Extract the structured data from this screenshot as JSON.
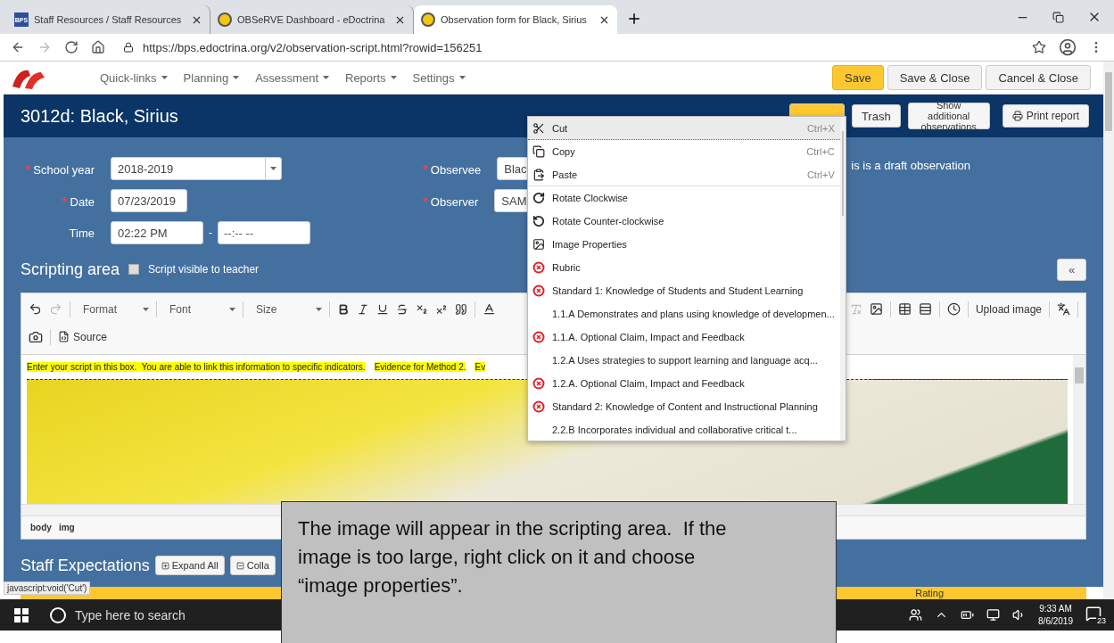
{
  "browser": {
    "tabs": [
      {
        "label": "Staff Resources / Staff Resources",
        "favicon": "BPS",
        "selected": false
      },
      {
        "label": "OBSeRVE Dashboard - eDoctrina",
        "selected": false
      },
      {
        "label": "Observation form for Black, Sirius",
        "selected": true
      }
    ],
    "url": "https://bps.edoctrina.org/v2/observation-script.html?rowid=156251"
  },
  "nav": {
    "menus": [
      "Quick-links",
      "Planning",
      "Assessment",
      "Reports",
      "Settings"
    ],
    "buttons": [
      {
        "label": "Save",
        "primary": true
      },
      {
        "label": "Save & Close",
        "primary": false
      },
      {
        "label": "Cancel & Close",
        "primary": false
      }
    ]
  },
  "header": {
    "title": "3012d: Black, Sirius",
    "buttons": [
      {
        "kind": "status"
      },
      {
        "kind": "plain",
        "label": "Trash"
      },
      {
        "kind": "plain",
        "label": "Show additional observations"
      },
      {
        "kind": "print",
        "label": "Print report"
      }
    ]
  },
  "form": {
    "left": [
      {
        "kind": "select",
        "marker": "*",
        "label": "School year",
        "value": "2018-2019"
      },
      {
        "kind": "date",
        "marker": "*",
        "label": "Date",
        "value": "07/23/2019"
      },
      {
        "kind": "time",
        "label": "Time",
        "value": "02:22 PM",
        "separator": "-",
        "end": {
          "placeholder": "--:-- --"
        }
      }
    ],
    "right": [
      {
        "marker": "*",
        "label": "Observee",
        "value": "Blac"
      },
      {
        "marker": "*",
        "label": "Observer",
        "value": "SAM"
      }
    ],
    "draft_note": "is is a draft observation"
  },
  "scripting": {
    "title": "Scripting area",
    "visible_to_teacher": {
      "label": "Script visible to teacher",
      "checked": false
    },
    "collapse": "«"
  },
  "editor": {
    "dropdowns": [
      "Format",
      "Font",
      "Size"
    ],
    "source": "Source",
    "upload": "Upload image",
    "segments": [
      "Enter your script in this box.  You are able to link this information to specific indicators.",
      "Evidence for Method 2.",
      "Ev"
    ],
    "path": [
      "body",
      "img"
    ]
  },
  "staff": {
    "title": "Staff Expectations",
    "buttons": [
      {
        "kind": "expand",
        "label": "Expand All"
      },
      {
        "kind": "collapse",
        "label": "Colla"
      }
    ],
    "rating": "Rating"
  },
  "status_link": "javascript:void('Cut')",
  "context_menu": {
    "items": [
      {
        "kind": "cut",
        "label": "Cut",
        "shortcut": "Ctrl+X",
        "highlighted": true,
        "separator_after": false
      },
      {
        "kind": "copy",
        "label": "Copy",
        "shortcut": "Ctrl+C",
        "highlighted": false,
        "separator_after": false
      },
      {
        "kind": "paste",
        "label": "Paste",
        "shortcut": "Ctrl+V",
        "highlighted": false,
        "separator_after": true
      },
      {
        "kind": "rotate-cw",
        "label": "Rotate Clockwise",
        "highlighted": false,
        "separator_after": false
      },
      {
        "kind": "rotate-ccw",
        "label": "Rotate Counter-clockwise",
        "highlighted": false,
        "separator_after": false
      },
      {
        "kind": "image",
        "label": "Image Properties",
        "highlighted": false,
        "separator_after": false
      },
      {
        "kind": "remove",
        "label": "Rubric",
        "highlighted": false,
        "separator_after": false
      },
      {
        "kind": "remove",
        "label": "Standard 1: Knowledge of Students and Student Learning",
        "highlighted": false,
        "separator_after": false
      },
      {
        "kind": "text",
        "label": "1.1.A Demonstrates and plans using knowledge of developmen...",
        "highlighted": false,
        "separator_after": false
      },
      {
        "kind": "remove",
        "label": "1.1.A. Optional Claim, Impact and Feedback",
        "highlighted": false,
        "separator_after": false
      },
      {
        "kind": "text",
        "label": "1.2.A Uses strategies to support learning and language acq...",
        "highlighted": false,
        "separator_after": false
      },
      {
        "kind": "remove",
        "label": "1.2.A. Optional Claim, Impact and Feedback",
        "highlighted": false,
        "separator_after": false
      },
      {
        "kind": "remove",
        "label": "Standard 2: Knowledge of Content and Instructional Planning",
        "highlighted": false,
        "separator_after": false
      },
      {
        "kind": "text",
        "label": "2.2.B Incorporates individual and collaborative critical t...",
        "highlighted": false
      }
    ]
  },
  "callout": "The image will appear in the scripting area.  If the image is too large, right click on it and choose “image properties”.",
  "taskbar": {
    "search": {
      "placeholder": "Type here to search"
    },
    "time": "9:33 AM",
    "date": "8/6/2019",
    "notifications": "23"
  }
}
